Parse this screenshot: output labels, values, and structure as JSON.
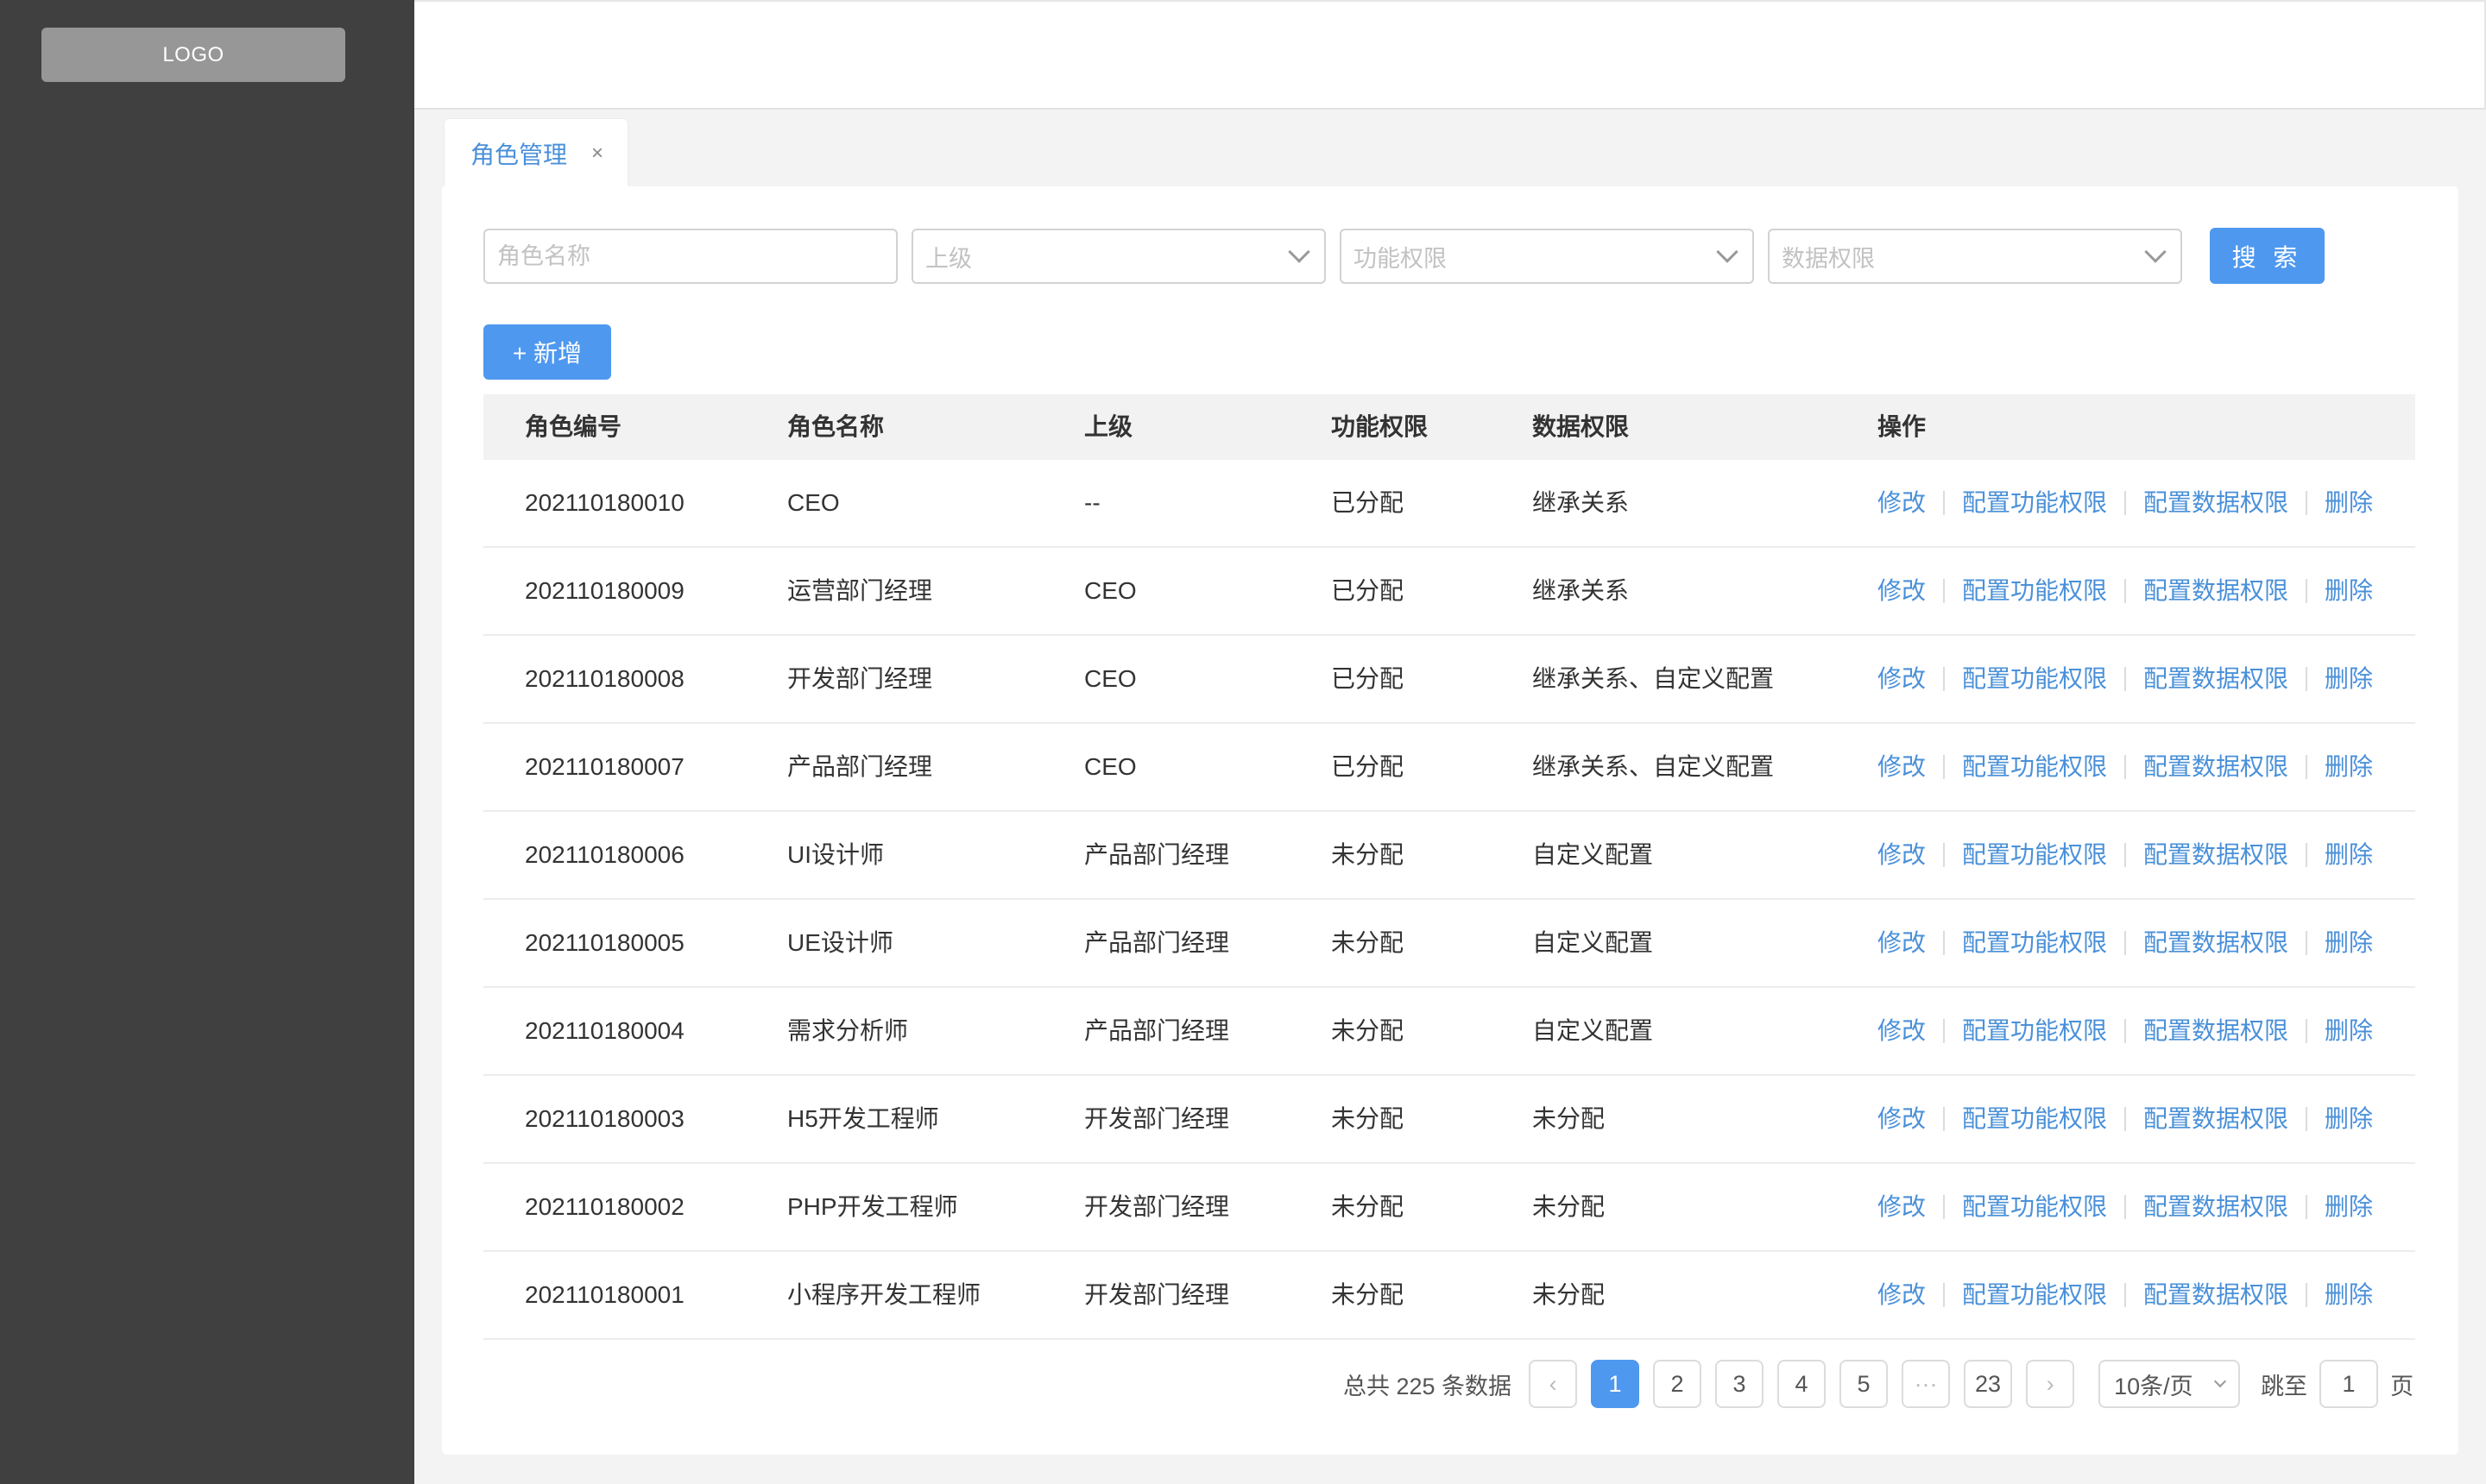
{
  "sidebar": {
    "logo": "LOGO"
  },
  "tabs": [
    {
      "label": "角色管理",
      "close": "×"
    }
  ],
  "filters": {
    "role_name_placeholder": "角色名称",
    "superior_placeholder": "上级",
    "function_perm_placeholder": "功能权限",
    "data_perm_placeholder": "数据权限",
    "search_label": "搜 索"
  },
  "toolbar": {
    "add_label": "+ 新增"
  },
  "table": {
    "headers": [
      "角色编号",
      "角色名称",
      "上级",
      "功能权限",
      "数据权限",
      "操作"
    ],
    "actions": [
      "修改",
      "配置功能权限",
      "配置数据权限",
      "删除"
    ],
    "rows": [
      [
        "202110180010",
        "CEO",
        "--",
        "已分配",
        "继承关系"
      ],
      [
        "202110180009",
        "运营部门经理",
        "CEO",
        "已分配",
        "继承关系"
      ],
      [
        "202110180008",
        "开发部门经理",
        "CEO",
        "已分配",
        "继承关系、自定义配置"
      ],
      [
        "202110180007",
        "产品部门经理",
        "CEO",
        "已分配",
        "继承关系、自定义配置"
      ],
      [
        "202110180006",
        "UI设计师",
        "产品部门经理",
        "未分配",
        "自定义配置"
      ],
      [
        "202110180005",
        "UE设计师",
        "产品部门经理",
        "未分配",
        "自定义配置"
      ],
      [
        "202110180004",
        "需求分析师",
        "产品部门经理",
        "未分配",
        "自定义配置"
      ],
      [
        "202110180003",
        "H5开发工程师",
        "开发部门经理",
        "未分配",
        "未分配"
      ],
      [
        "202110180002",
        "PHP开发工程师",
        "开发部门经理",
        "未分配",
        "未分配"
      ],
      [
        "202110180001",
        "小程序开发工程师",
        "开发部门经理",
        "未分配",
        "未分配"
      ]
    ]
  },
  "pagination": {
    "total_text": "总共 225 条数据",
    "prev": "‹",
    "pages": [
      "1",
      "2",
      "3",
      "4",
      "5",
      "···",
      "23"
    ],
    "current_page": "1",
    "next": "›",
    "page_size": "10条/页",
    "jump_label": "跳至",
    "jump_value": "1",
    "jump_suffix": "页"
  },
  "colors": {
    "accent": "#4e98ef",
    "link": "#4a90d9",
    "sidebar": "#404040"
  }
}
